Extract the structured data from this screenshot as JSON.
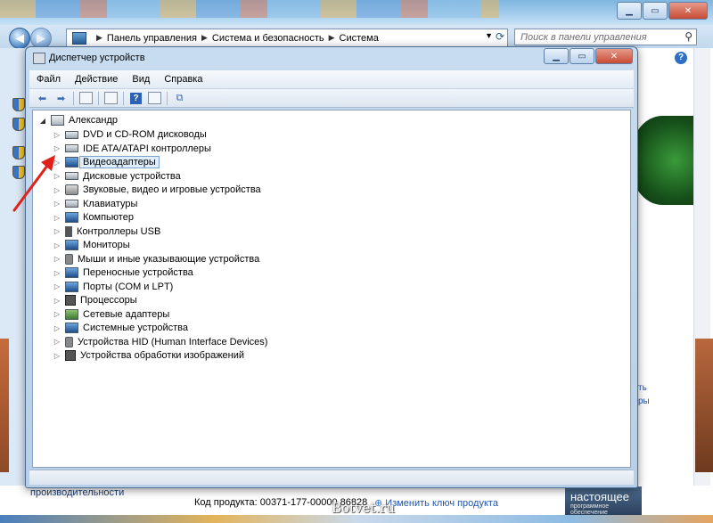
{
  "control_panel": {
    "breadcrumb": [
      "Панель управления",
      "Система и безопасность",
      "Система"
    ],
    "search_placeholder": "Поиск в панели управления",
    "left_link_text": "производительности",
    "product_label": "Код продукта:  00371-177-00000",
    "product_id_tail": "86828",
    "change_key_link": "Изменить ключ продукта",
    "side_links": [
      "ть",
      "ры"
    ],
    "help_glyph": "?",
    "genuine_badge": {
      "title": "настоящее",
      "subtitle": "программное обеспечение"
    }
  },
  "watermark": "Botvet.ru",
  "device_manager": {
    "title": "Диспетчер устройств",
    "menu": [
      "Файл",
      "Действие",
      "Вид",
      "Справка"
    ],
    "toolbar_icons": [
      "back-arrow-icon",
      "forward-arrow-icon",
      "properties-icon",
      "console-tree-icon",
      "help-icon",
      "scan-hardware-icon"
    ],
    "root": {
      "label": "Александр",
      "expanded": true
    },
    "categories": [
      {
        "label": "DVD и CD-ROM дисководы",
        "icon": "dvd-drive-icon"
      },
      {
        "label": "IDE ATA/ATAPI контроллеры",
        "icon": "ide-controller-icon"
      },
      {
        "label": "Видеоадаптеры",
        "icon": "display-adapter-icon",
        "selected": true
      },
      {
        "label": "Дисковые устройства",
        "icon": "disk-drive-icon"
      },
      {
        "label": "Звуковые, видео и игровые устройства",
        "icon": "sound-icon"
      },
      {
        "label": "Клавиатуры",
        "icon": "keyboard-icon"
      },
      {
        "label": "Компьютер",
        "icon": "computer-icon"
      },
      {
        "label": "Контроллеры USB",
        "icon": "usb-icon"
      },
      {
        "label": "Мониторы",
        "icon": "monitor-icon"
      },
      {
        "label": "Мыши и иные указывающие устройства",
        "icon": "mouse-icon"
      },
      {
        "label": "Переносные устройства",
        "icon": "portable-device-icon"
      },
      {
        "label": "Порты (COM и LPT)",
        "icon": "port-icon"
      },
      {
        "label": "Процессоры",
        "icon": "processor-icon"
      },
      {
        "label": "Сетевые адаптеры",
        "icon": "network-adapter-icon"
      },
      {
        "label": "Системные устройства",
        "icon": "system-device-icon"
      },
      {
        "label": "Устройства HID (Human Interface Devices)",
        "icon": "hid-icon"
      },
      {
        "label": "Устройства обработки изображений",
        "icon": "imaging-device-icon"
      }
    ]
  },
  "colors": {
    "accent": "#3b6db0",
    "annotation_arrow": "#e0201a",
    "selection": "#dfeefc"
  }
}
